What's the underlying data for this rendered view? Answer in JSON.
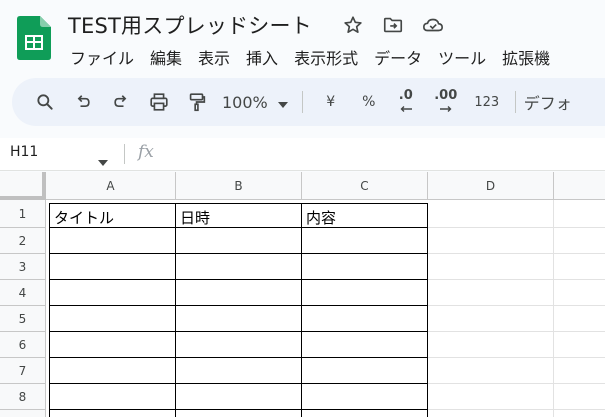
{
  "document": {
    "title": "TEST用スプレッドシート"
  },
  "title_icons": [
    "star-icon",
    "move-to-folder-icon",
    "cloud-status-icon"
  ],
  "menu": [
    "ファイル",
    "編集",
    "表示",
    "挿入",
    "表示形式",
    "データ",
    "ツール",
    "拡張機"
  ],
  "toolbar": {
    "zoom": "100%",
    "currency_symbol": "¥",
    "percent_symbol": "%",
    "decrease_decimal": ".0",
    "increase_decimal": ".00",
    "number_format": "123",
    "font_default": "デフォ"
  },
  "formula_bar": {
    "cell_reference": "H11",
    "fx_label": "fx",
    "value": ""
  },
  "grid": {
    "columns": [
      "A",
      "B",
      "C",
      "D"
    ],
    "rows": [
      "1",
      "2",
      "3",
      "4",
      "5",
      "6",
      "7",
      "8"
    ],
    "header_row": [
      "タイトル",
      "日時",
      "内容"
    ]
  },
  "colors": {
    "sheets_green": "#0f9d58",
    "toolbar_bg": "#edf2fa",
    "app_bg": "#f9fbfd"
  }
}
